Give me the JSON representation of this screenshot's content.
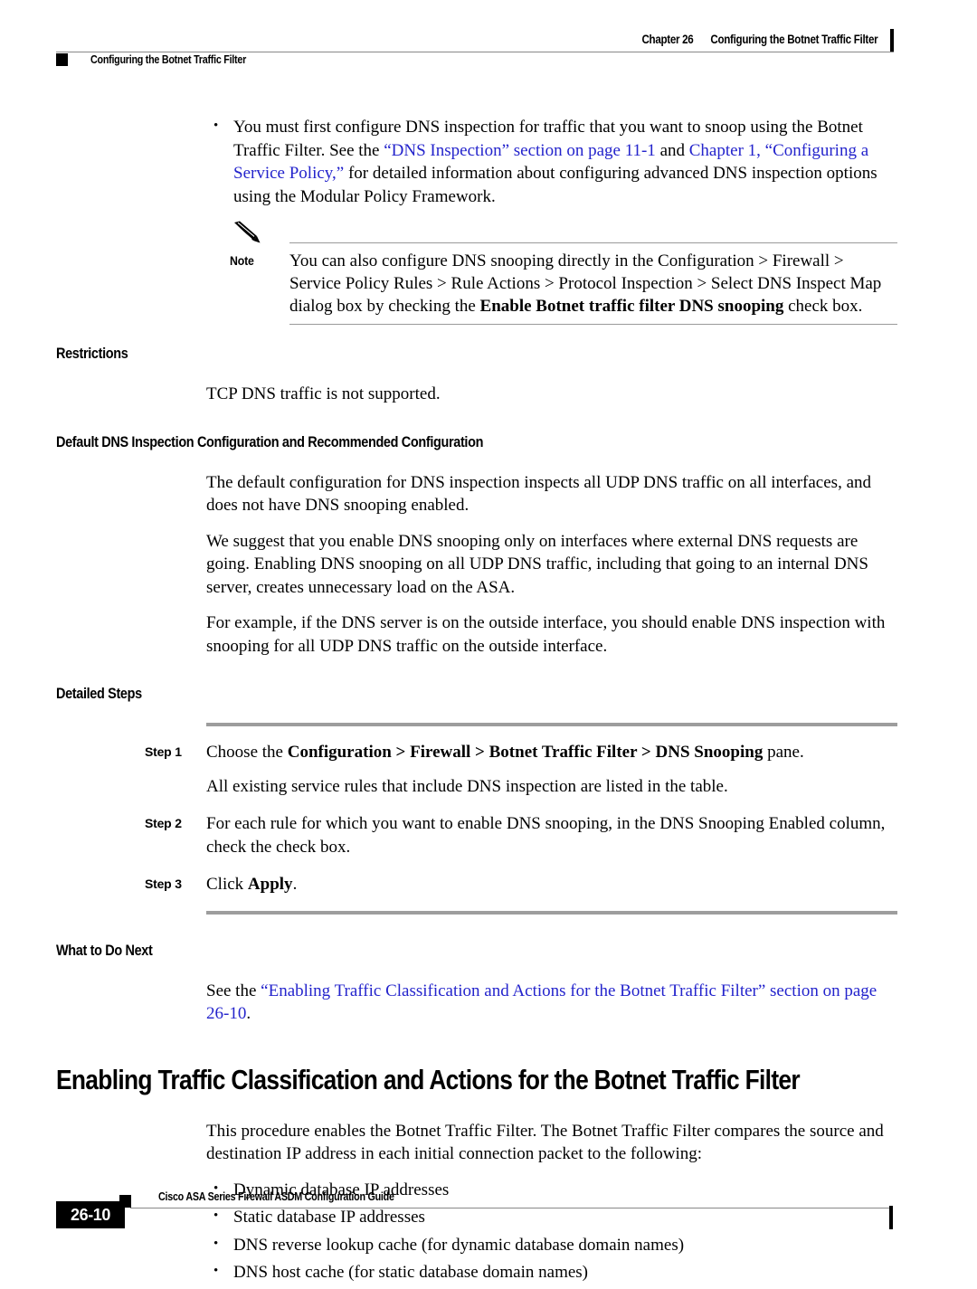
{
  "header": {
    "chapter_number": "Chapter 26",
    "chapter_title": "Configuring the Botnet Traffic Filter",
    "running_head": "Configuring the Botnet Traffic Filter"
  },
  "intro_bullet": {
    "part1": "You must first configure DNS inspection for traffic that you want to snoop using the Botnet Traffic Filter. See the ",
    "link1": "“DNS Inspection” section on page 11-1",
    "part2": " and ",
    "link2": "Chapter 1, “Configuring a Service Policy,”",
    "part3": " for detailed information about configuring advanced DNS inspection options using the Modular Policy Framework."
  },
  "note": {
    "label": "Note",
    "text_before": "You can also configure DNS snooping directly in the Configuration > Firewall > Service Policy Rules > Rule Actions > Protocol Inspection > Select DNS Inspect Map dialog box by checking the ",
    "text_bold": "Enable Botnet traffic filter DNS snooping",
    "text_after": " check box."
  },
  "restrictions": {
    "heading": "Restrictions",
    "body": "TCP DNS traffic is not supported."
  },
  "default_config": {
    "heading": "Default DNS Inspection Configuration and Recommended Configuration",
    "para1": "The default configuration for DNS inspection inspects all UDP DNS traffic on all interfaces, and does not have DNS snooping enabled.",
    "para2": "We suggest that you enable DNS snooping only on interfaces where external DNS requests are going. Enabling DNS snooping on all UDP DNS traffic, including that going to an internal DNS server, creates unnecessary load on the ASA.",
    "para3": "For example, if the DNS server is on the outside interface, you should enable DNS inspection with snooping for all UDP DNS traffic on the outside interface."
  },
  "detailed_steps": {
    "heading": "Detailed Steps",
    "steps": [
      {
        "label": "Step 1",
        "text_before": "Choose the ",
        "text_bold": "Configuration > Firewall > Botnet Traffic Filter > DNS Snooping",
        "text_after": " pane.",
        "sub": "All existing service rules that include DNS inspection are listed in the table."
      },
      {
        "label": "Step 2",
        "text_before": "For each rule for which you want to enable DNS snooping, in the DNS Snooping Enabled column, check the check box.",
        "text_bold": "",
        "text_after": "",
        "sub": ""
      },
      {
        "label": "Step 3",
        "text_before": "Click ",
        "text_bold": "Apply",
        "text_after": ".",
        "sub": ""
      }
    ]
  },
  "what_next": {
    "heading": "What to Do Next",
    "text_before": "See the ",
    "link": "“Enabling Traffic Classification and Actions for the Botnet Traffic Filter” section on page 26-10",
    "text_after": "."
  },
  "main_section": {
    "heading": "Enabling Traffic Classification and Actions for the Botnet Traffic Filter",
    "intro": "This procedure enables the Botnet Traffic Filter. The Botnet Traffic Filter compares the source and destination IP address in each initial connection packet to the following:",
    "bullets": [
      "Dynamic database IP addresses",
      "Static database IP addresses",
      "DNS reverse lookup cache (for dynamic database domain names)",
      "DNS host cache (for static database domain names)"
    ]
  },
  "footer": {
    "guide_title": "Cisco ASA Series Firewall ASDM Configuration Guide",
    "page_number": "26-10"
  },
  "colors": {
    "link": "#2424CC",
    "rule_gray": "#9a9a9a",
    "step_rule_gray": "#9d9d9d",
    "black": "#000000"
  }
}
